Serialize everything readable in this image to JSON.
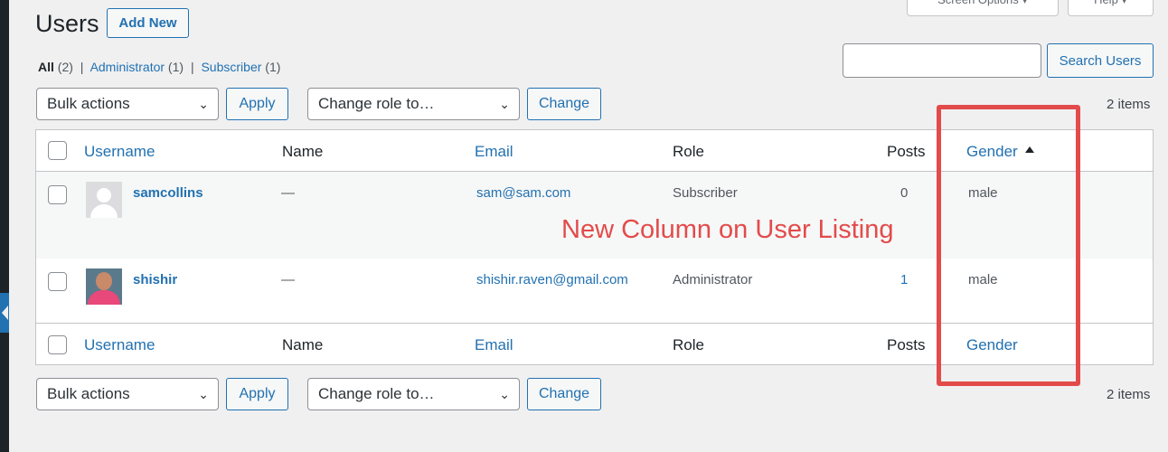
{
  "top_tabs": {
    "screen_options": "Screen Options ▾",
    "help": "Help ▾"
  },
  "page": {
    "title": "Users",
    "add_new": "Add New"
  },
  "filters": [
    {
      "label": "All",
      "count": "(2)"
    },
    {
      "label": "Administrator",
      "count": "(1)"
    },
    {
      "label": "Subscriber",
      "count": "(1)"
    }
  ],
  "search": {
    "value": "",
    "button": "Search Users"
  },
  "controls": {
    "bulk_actions": "Bulk actions",
    "apply": "Apply",
    "change_role": "Change role to…",
    "change": "Change",
    "items_count": "2 items"
  },
  "table": {
    "columns": {
      "username": "Username",
      "name": "Name",
      "email": "Email",
      "role": "Role",
      "posts": "Posts",
      "gender": "Gender"
    },
    "rows": [
      {
        "username": "samcollins",
        "name": "—",
        "email": "sam@sam.com",
        "role": "Subscriber",
        "posts": "0",
        "gender": "male"
      },
      {
        "username": "shishir",
        "name": "—",
        "email": "shishir.raven@gmail.com",
        "role": "Administrator",
        "posts": "1",
        "gender": "male"
      }
    ]
  },
  "annotation": {
    "text": "New Column on User Listing",
    "color": "#e34b4b"
  },
  "colors": {
    "link": "#2271b1",
    "background": "#f0f0f1",
    "text": "#1d2327"
  }
}
